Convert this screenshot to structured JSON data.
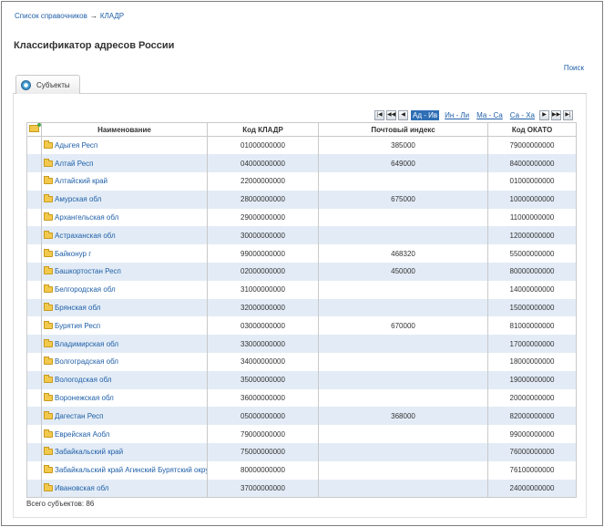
{
  "breadcrumb": {
    "parent": "Список справочников",
    "separator": "→",
    "current": "КЛАДР"
  },
  "page": {
    "title": "Классификатор адресов России",
    "search_link": "Поиск"
  },
  "tabs": [
    {
      "label": "Субъекты",
      "icon": "globe-icon"
    }
  ],
  "pager": {
    "buttons": [
      "first-page-icon",
      "prev-block-icon",
      "prev-page-icon"
    ],
    "ranges": [
      "Ад - Ив",
      "Ин - Ли",
      "Ма - Са",
      "Са - Ха"
    ],
    "active_range": "Ад - Ив",
    "buttons_right": [
      "next-page-icon",
      "next-block-icon",
      "last-page-icon"
    ]
  },
  "table": {
    "columns": [
      "Наименование",
      "Код КЛАДР",
      "Почтовый индекс",
      "Код ОКАТО"
    ],
    "rows": [
      [
        "Адыгея Респ",
        "01000000000",
        "385000",
        "79000000000"
      ],
      [
        "Алтай Респ",
        "04000000000",
        "649000",
        "84000000000"
      ],
      [
        "Алтайский край",
        "22000000000",
        "",
        "01000000000"
      ],
      [
        "Амурская обл",
        "28000000000",
        "675000",
        "10000000000"
      ],
      [
        "Архангельская обл",
        "29000000000",
        "",
        "11000000000"
      ],
      [
        "Астраханская обл",
        "30000000000",
        "",
        "12000000000"
      ],
      [
        "Байконур г",
        "99000000000",
        "468320",
        "55000000000"
      ],
      [
        "Башкортостан Респ",
        "02000000000",
        "450000",
        "80000000000"
      ],
      [
        "Белгородская обл",
        "31000000000",
        "",
        "14000000000"
      ],
      [
        "Брянская обл",
        "32000000000",
        "",
        "15000000000"
      ],
      [
        "Бурятия Респ",
        "03000000000",
        "670000",
        "81000000000"
      ],
      [
        "Владимирская обл",
        "33000000000",
        "",
        "17000000000"
      ],
      [
        "Волгоградская обл",
        "34000000000",
        "",
        "18000000000"
      ],
      [
        "Вологодская обл",
        "35000000000",
        "",
        "19000000000"
      ],
      [
        "Воронежская обл",
        "36000000000",
        "",
        "20000000000"
      ],
      [
        "Дагестан Респ",
        "05000000000",
        "368000",
        "82000000000"
      ],
      [
        "Еврейская Аобл",
        "79000000000",
        "",
        "99000000000"
      ],
      [
        "Забайкальский край",
        "75000000000",
        "",
        "76000000000"
      ],
      [
        "Забайкальский край Агинский Бурятский округ",
        "80000000000",
        "",
        "76100000000"
      ],
      [
        "Ивановская обл",
        "37000000000",
        "",
        "24000000000"
      ]
    ]
  },
  "footer": {
    "total": "Всего субъектов: 86"
  }
}
